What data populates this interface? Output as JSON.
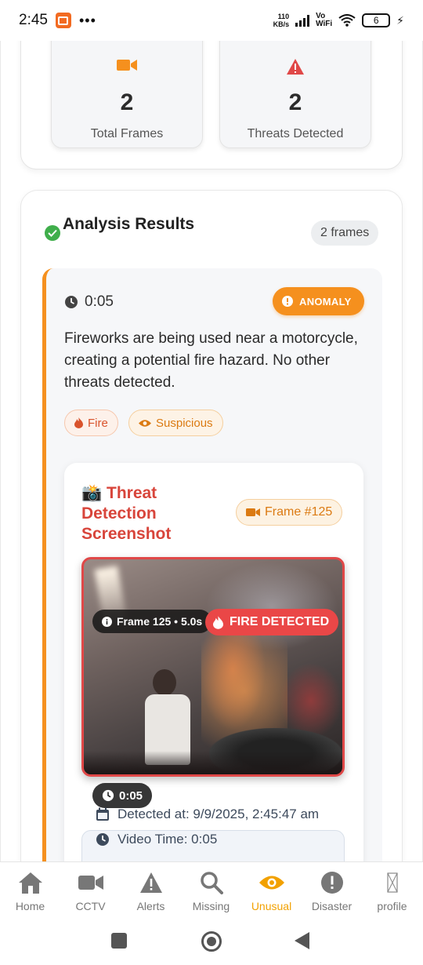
{
  "status_bar": {
    "time": "2:45",
    "dots": "•••",
    "net_speed_value": "110",
    "net_speed_unit": "KB/s",
    "vowifi_line1": "Vo",
    "vowifi_line2": "WiFi",
    "battery": "6"
  },
  "stats": {
    "total_frames_value": "2",
    "total_frames_label": "Total Frames",
    "threats_value": "2",
    "threats_label": "Threats Detected"
  },
  "results": {
    "title": "Analysis Results",
    "frames_badge": "2 frames",
    "timestamp": "0:05",
    "anomaly_label": "ANOMALY",
    "description": "Fireworks are being used near a motorcycle, creating a potential fire hazard. No other threats detected.",
    "tags": [
      "Fire",
      "Suspicious"
    ],
    "screenshot": {
      "emoji": "📸",
      "title": "Threat Detection Screenshot",
      "frame_badge": "Frame #125",
      "photo_label": "Frame 125 • 5.0s",
      "fire_label": "FIRE DETECTED",
      "photo_time": "0:05",
      "detected_at": "Detected at: 9/9/2025, 2:45:47 am",
      "video_time": "Video Time: 0:05"
    }
  },
  "bottom_nav": {
    "items": [
      "Home",
      "CCTV",
      "Alerts",
      "Missing",
      "Unusual",
      "Disaster",
      "profile"
    ],
    "active": "Unusual"
  },
  "colors": {
    "accent_orange": "#f5901e",
    "danger_red": "#e04848",
    "nav_active": "#f2a100"
  }
}
